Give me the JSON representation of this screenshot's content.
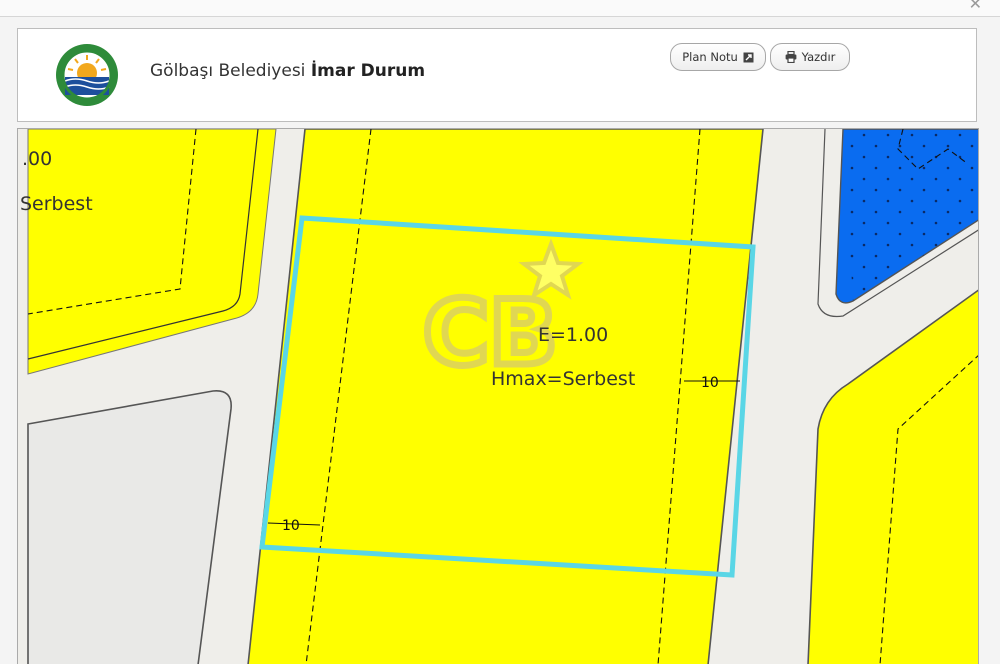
{
  "window": {
    "close_icon": "close-icon"
  },
  "header": {
    "municipality": "Gölbaşı Belediyesi",
    "section": "İmar Durum",
    "logo_icon": "municipality-seal-icon",
    "buttons": {
      "plan_note": {
        "label": "Plan Notu",
        "icon": "external-link-icon"
      },
      "print": {
        "label": "Yazdır",
        "icon": "printer-icon"
      }
    }
  },
  "map": {
    "parcel_labels": {
      "far": "E=1.00",
      "height": "Hmax=Serbest"
    },
    "left_parcel_labels": {
      "far": ".00",
      "height": "Serbest"
    },
    "setbacks": {
      "right": "10",
      "bottom_left": "10"
    },
    "watermark": "CB",
    "colors": {
      "zone": "#ffff00",
      "road": "#efeeea",
      "green_area": "#0a6cf0",
      "parcel_outline": "#5ad6e6",
      "watermark": "#d8cc6a"
    }
  }
}
